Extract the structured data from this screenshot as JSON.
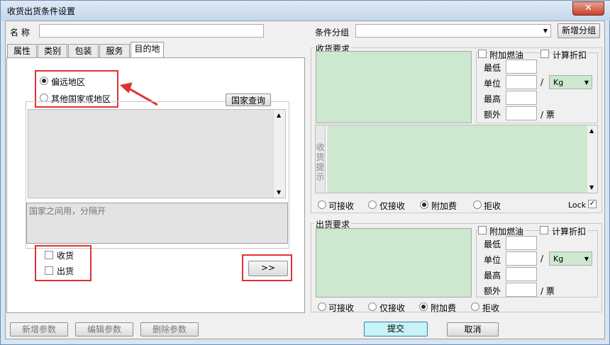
{
  "window": {
    "title": "收货出货条件设置",
    "close_glyph": "✕"
  },
  "name_field": {
    "label": "名 称",
    "value": ""
  },
  "condition_group": {
    "label": "条件分组",
    "value": "",
    "new_button": "新增分组"
  },
  "tabs": [
    "属性",
    "类别",
    "包装",
    "服务",
    "目的地"
  ],
  "destination": {
    "radio_remote": "偏远地区",
    "radio_other": "其他国家或地区",
    "country_query": "国家查询",
    "hint_placeholder": "国家之间用，分隔开",
    "check_receive": "收货",
    "check_ship": "出货",
    "move_button": ">>"
  },
  "receive": {
    "title": "收货要求",
    "fuel": "附加燃油",
    "discount": "计算折扣",
    "min": "最低",
    "unit": "单位",
    "slash": "/",
    "unit_value": "Kg",
    "max": "最高",
    "extra": "额外",
    "per_ticket": "/ 票",
    "hint_side": "收货提示",
    "options": [
      "可接收",
      "仅接收",
      "附加费",
      "拒收"
    ],
    "lock": "Lock",
    "lock_check": "✓"
  },
  "ship": {
    "title": "出货要求",
    "fuel": "附加燃油",
    "discount": "计算折扣",
    "min": "最低",
    "unit": "单位",
    "slash": "/",
    "unit_value": "Kg",
    "max": "最高",
    "extra": "额外",
    "per_ticket": "/ 票",
    "options": [
      "可接收",
      "仅接收",
      "附加费",
      "拒收"
    ]
  },
  "footer": {
    "add_param": "新增参数",
    "edit_param": "编辑参数",
    "delete_param": "删除参数",
    "submit": "提交",
    "cancel": "取消"
  },
  "colors": {
    "highlight_red": "#e03131",
    "green_area": "#cce8cf",
    "submit_bg": "#c5f3f6"
  }
}
